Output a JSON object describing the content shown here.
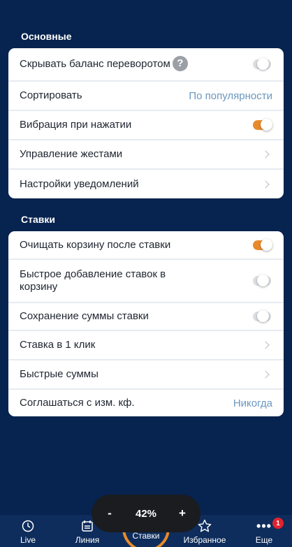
{
  "header": {
    "title_fragment": "—"
  },
  "sections": {
    "main": {
      "title": "Основные",
      "rows": [
        {
          "label": "Скрывать баланс переворотом",
          "control": "toggle",
          "state": "off",
          "help_icon": "question-icon"
        },
        {
          "label": "Сортировать",
          "control": "value",
          "value": "По популярности"
        },
        {
          "label": "Вибрация при нажатии",
          "control": "toggle",
          "state": "on"
        },
        {
          "label": "Управление жестами",
          "control": "chevron"
        },
        {
          "label": "Настройки уведомлений",
          "control": "chevron"
        }
      ]
    },
    "bets": {
      "title": "Ставки",
      "rows": [
        {
          "label": "Очищать корзину после ставки",
          "control": "toggle",
          "state": "on"
        },
        {
          "label": "Быстрое добавление ставок в корзину",
          "control": "toggle",
          "state": "off"
        },
        {
          "label": "Сохранение суммы ставки",
          "control": "toggle",
          "state": "off"
        },
        {
          "label": "Ставка в 1 клик",
          "control": "chevron"
        },
        {
          "label": "Быстрые суммы",
          "control": "chevron"
        },
        {
          "label": "Соглашаться с изм. кф.",
          "control": "value",
          "value": "Никогда"
        }
      ]
    }
  },
  "bottom_nav": {
    "items": [
      {
        "label": "Live",
        "icon": "clock-icon"
      },
      {
        "label": "Линия",
        "icon": "calendar-icon"
      },
      {
        "label": "Ставки",
        "icon": "bets-icon",
        "active": true
      },
      {
        "label": "Избранное",
        "icon": "star-icon"
      },
      {
        "label": "Еще",
        "icon": "more-icon",
        "badge": "1"
      }
    ]
  },
  "zoom": {
    "value": "42%",
    "minus": "-",
    "plus": "+"
  },
  "colors": {
    "background": "#07234f",
    "accent": "#e98a2a",
    "link": "#6a96bf",
    "badge": "#e1232e"
  }
}
